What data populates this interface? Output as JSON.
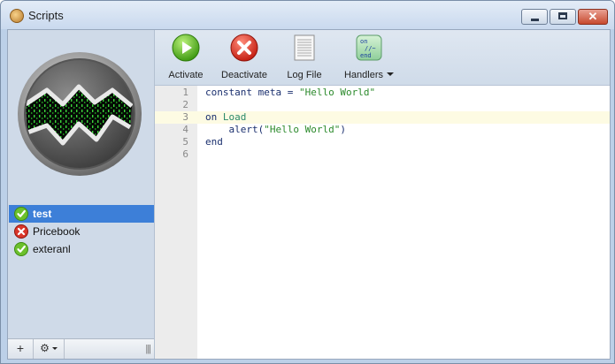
{
  "window": {
    "title": "Scripts",
    "close_glyph": "✕"
  },
  "scripts": [
    {
      "name": "test",
      "status": "active",
      "selected": true
    },
    {
      "name": "Pricebook",
      "status": "error",
      "selected": false
    },
    {
      "name": "exteranl",
      "status": "active",
      "selected": false
    }
  ],
  "footer": {
    "add_glyph": "+",
    "gear_glyph": "⚙",
    "grip_glyph": "|||"
  },
  "toolbar": {
    "activate_label": "Activate",
    "deactivate_label": "Deactivate",
    "logfile_label": "Log File",
    "handlers_label": "Handlers",
    "handlers_icon_lines": [
      "on",
      "//~",
      "end"
    ]
  },
  "editor": {
    "current_line": 3,
    "lines": [
      {
        "number": "1",
        "text": "constant meta = \"Hello World\""
      },
      {
        "number": "2",
        "text": ""
      },
      {
        "number": "3",
        "text": "on Load"
      },
      {
        "number": "4",
        "text": "    alert(\"Hello World\")"
      },
      {
        "number": "5",
        "text": "end"
      },
      {
        "number": "6",
        "text": ""
      }
    ]
  },
  "colors": {
    "selection": "#3d7fd8",
    "current_line": "#fdfbe3",
    "string": "#2c8a2c",
    "keyword": "#1a2f6e"
  }
}
